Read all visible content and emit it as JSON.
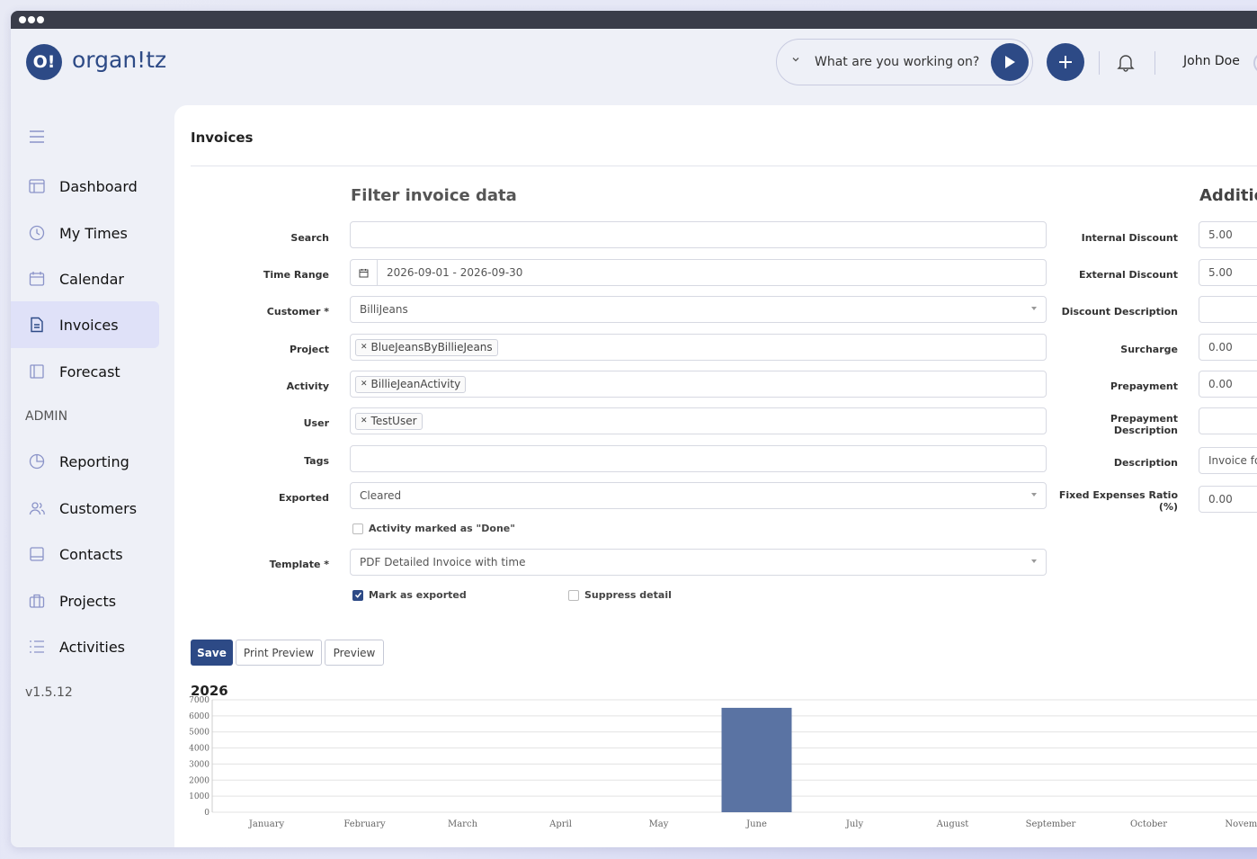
{
  "app": {
    "logo_mark": "O!",
    "logo_text": "organ!tz",
    "version": "v1.5.12"
  },
  "header": {
    "tracker_placeholder": "What are you working on?",
    "user_name": "John Doe"
  },
  "sidebar": {
    "items": [
      {
        "label": "Dashboard",
        "icon": "dashboard-icon"
      },
      {
        "label": "My Times",
        "icon": "clock-icon"
      },
      {
        "label": "Calendar",
        "icon": "calendar-icon"
      },
      {
        "label": "Invoices",
        "icon": "invoice-icon",
        "active": true
      },
      {
        "label": "Forecast",
        "icon": "forecast-icon"
      }
    ],
    "admin_label": "ADMIN",
    "admin_items": [
      {
        "label": "Reporting",
        "icon": "pie-chart-icon"
      },
      {
        "label": "Customers",
        "icon": "users-icon"
      },
      {
        "label": "Contacts",
        "icon": "contacts-icon"
      },
      {
        "label": "Projects",
        "icon": "briefcase-icon"
      },
      {
        "label": "Activities",
        "icon": "list-icon"
      }
    ]
  },
  "page": {
    "title": "Invoices"
  },
  "filter": {
    "title": "Filter invoice data",
    "search_label": "Search",
    "search_value": "",
    "time_range_label": "Time Range",
    "time_range_value": "2026-09-01 - 2026-09-30",
    "customer_label": "Customer *",
    "customer_value": "BilliJeans",
    "project_label": "Project",
    "project_chip": "BlueJeansByBillieJeans",
    "activity_label": "Activity",
    "activity_chip": "BillieJeanActivity",
    "user_label": "User",
    "user_chip": "TestUser",
    "tags_label": "Tags",
    "exported_label": "Exported",
    "exported_value": "Cleared",
    "done_checkbox": "Activity marked as \"Done\"",
    "done_checked": false,
    "template_label": "Template *",
    "template_value": "PDF Detailed Invoice with time",
    "mark_exported": "Mark as exported",
    "mark_exported_checked": true,
    "suppress_detail": "Suppress detail",
    "suppress_detail_checked": false
  },
  "additional": {
    "title": "Additio",
    "internal_discount_label": "Internal Discount",
    "internal_discount_value": "5.00",
    "external_discount_label": "External Discount",
    "external_discount_value": "5.00",
    "discount_description_label": "Discount Description",
    "discount_description_value": "",
    "surcharge_label": "Surcharge",
    "surcharge_value": "0.00",
    "prepayment_label": "Prepayment",
    "prepayment_value": "0.00",
    "prepayment_description_label_1": "Prepayment",
    "prepayment_description_label_2": "Description",
    "prepayment_description_value": "",
    "description_label": "Description",
    "description_value": "Invoice fo",
    "fixed_expenses_label_1": "Fixed Expenses Ratio",
    "fixed_expenses_label_2": "(%)",
    "fixed_expenses_value": "0.00"
  },
  "actions": {
    "save": "Save",
    "print_preview": "Print Preview",
    "preview": "Preview"
  },
  "colors": {
    "primary": "#2d4a86",
    "bar": "#5a73a3",
    "active_nav": "#dfe1f8"
  },
  "chart_data": {
    "type": "bar",
    "title": "2026",
    "categories": [
      "January",
      "February",
      "March",
      "April",
      "May",
      "June",
      "July",
      "August",
      "September",
      "October",
      "Novembe"
    ],
    "values": [
      0,
      0,
      0,
      0,
      0,
      6500,
      0,
      0,
      0,
      0,
      0
    ],
    "yticks": [
      0,
      1000,
      2000,
      3000,
      4000,
      5000,
      6000,
      7000
    ],
    "ylim": [
      0,
      7000
    ],
    "grid": true
  }
}
